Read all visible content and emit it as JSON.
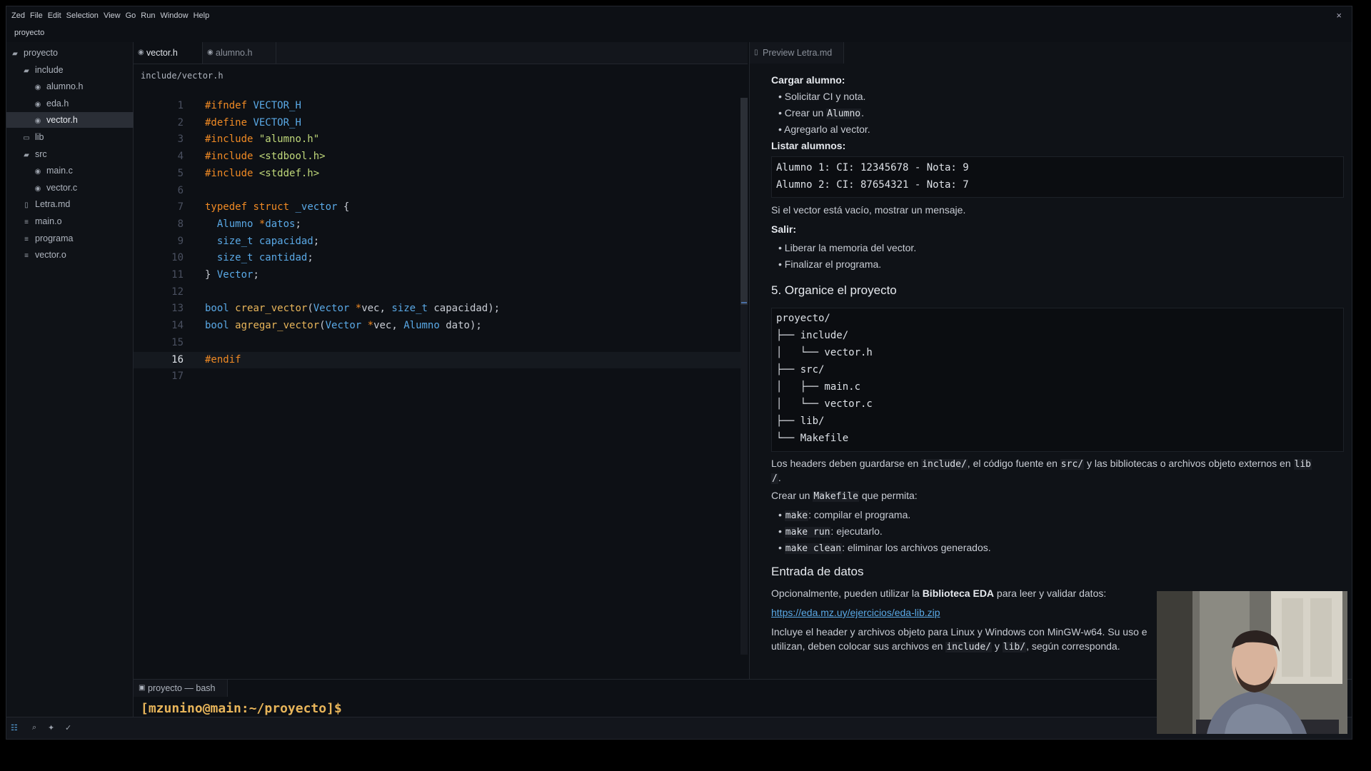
{
  "menubar": {
    "items": [
      "Zed",
      "File",
      "Edit",
      "Selection",
      "View",
      "Go",
      "Run",
      "Window",
      "Help"
    ],
    "close": "×"
  },
  "project_name": "proyecto",
  "sidebar": {
    "items": [
      {
        "label": "proyecto",
        "icon": "folder-open-icon"
      },
      {
        "label": "include",
        "icon": "folder-open-icon"
      },
      {
        "label": "alumno.h",
        "icon": "c-file-icon"
      },
      {
        "label": "eda.h",
        "icon": "c-file-icon"
      },
      {
        "label": "vector.h",
        "icon": "c-file-icon"
      },
      {
        "label": "lib",
        "icon": "folder-icon"
      },
      {
        "label": "src",
        "icon": "folder-open-icon"
      },
      {
        "label": "main.c",
        "icon": "c-file-icon"
      },
      {
        "label": "vector.c",
        "icon": "c-file-icon"
      },
      {
        "label": "Letra.md",
        "icon": "book-icon"
      },
      {
        "label": "main.o",
        "icon": "file-icon"
      },
      {
        "label": "programa",
        "icon": "file-icon"
      },
      {
        "label": "vector.o",
        "icon": "file-icon"
      }
    ]
  },
  "editor": {
    "tabs": [
      "vector.h",
      "alumno.h"
    ],
    "breadcrumb": "include/vector.h",
    "line_numbers": [
      "1",
      "2",
      "3",
      "4",
      "5",
      "6",
      "7",
      "8",
      "9",
      "10",
      "11",
      "12",
      "13",
      "14",
      "15",
      "16",
      "17"
    ],
    "current_line": 16
  },
  "preview": {
    "tab": "Preview Letra.md",
    "cargar_title": "Cargar alumno:",
    "cargar_b1": "Solicitar CI y nota.",
    "cargar_b2_pre": "Crear un ",
    "cargar_b2_code": "Alumno",
    "cargar_b2_post": ".",
    "cargar_b3": "Agregarlo al vector.",
    "listar_title": "Listar alumnos:",
    "listar_code": [
      "Alumno 1: CI: 12345678 - Nota: 9",
      "Alumno 2: CI: 87654321 - Nota: 7"
    ],
    "vacio": "Si el vector está vacío, mostrar un mensaje.",
    "salir_title": "Salir:",
    "salir_b1": "Liberar la memoria del vector.",
    "salir_b2": "Finalizar el programa.",
    "h_organice": "5. Organice el proyecto",
    "tree_code": [
      "proyecto/",
      "├── include/",
      "│   └── vector.h",
      "├── src/",
      "│   ├── main.c",
      "│   └── vector.c",
      "├── lib/",
      "└── Makefile"
    ],
    "headers_1": "Los headers deben guardarse en ",
    "headers_c1": "include/",
    "headers_2": ", el código fuente en ",
    "headers_c2": "src/",
    "headers_3": " y las bibliotecas o archivos objeto externos en ",
    "headers_c3a": "lib",
    "headers_c3b": "/",
    "headers_4": ".",
    "makefile_pre": "Crear un ",
    "makefile_code": "Makefile",
    "makefile_post": " que permita:",
    "mk_b1_code": "make",
    "mk_b1": ": compilar el programa.",
    "mk_b2_code": "make run",
    "mk_b2": ": ejecutarlo.",
    "mk_b3_code": "make clean",
    "mk_b3": ": eliminar los archivos generados.",
    "h_entrada": "Entrada de datos",
    "opc_pre": "Opcionalmente, pueden utilizar la ",
    "opc_bold": "Biblioteca EDA",
    "opc_post": " para leer y validar datos:",
    "link": "https://eda.mz.uy/ejercicios/eda-lib.zip",
    "incluye_1": "Incluye el header y archivos objeto para Linux y Windows con MinGW-w64. Su uso e",
    "incluye_2_pre": "utilizan, deben colocar sus archivos en ",
    "incluye_2_c1": "include/",
    "incluye_2_mid": " y ",
    "incluye_2_c2": "lib/",
    "incluye_2_post": ", según corresponda."
  },
  "terminal": {
    "tab": "proyecto — bash",
    "prompt": "[mzunino@main:~/proyecto]$"
  },
  "colors": {
    "keyword": "#f08a24",
    "type": "#5aa9e6",
    "function": "#e8b55a",
    "string": "#c0d87a",
    "background": "#0d1015"
  }
}
